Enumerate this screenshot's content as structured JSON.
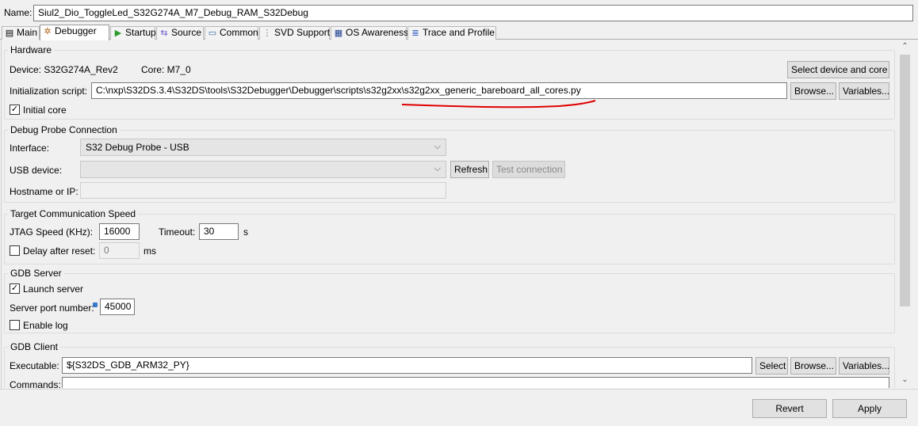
{
  "name_row": {
    "label": "Name:",
    "value": "Siul2_Dio_ToggleLed_S32G274A_M7_Debug_RAM_S32Debug"
  },
  "tabs": [
    {
      "label": "Main",
      "icon": "document-icon"
    },
    {
      "label": "Debugger",
      "icon": "bug-icon"
    },
    {
      "label": "Startup",
      "icon": "play-icon"
    },
    {
      "label": "Source",
      "icon": "source-icon"
    },
    {
      "label": "Common",
      "icon": "window-icon"
    },
    {
      "label": "SVD Support",
      "icon": "registers-icon"
    },
    {
      "label": "OS Awareness",
      "icon": "os-icon"
    },
    {
      "label": "Trace and Profile",
      "icon": "trace-icon"
    }
  ],
  "hardware": {
    "title": "Hardware",
    "device": "Device: S32G274A_Rev2",
    "core": "Core: M7_0",
    "select_button": "Select device and core",
    "init_label": "Initialization script:",
    "init_value": "C:\\nxp\\S32DS.3.4\\S32DS\\tools\\S32Debugger\\Debugger\\scripts\\s32g2xx\\s32g2xx_generic_bareboard_all_cores.py",
    "browse": "Browse...",
    "variables": "Variables...",
    "initial_core": "Initial core",
    "annotation_color": "#e00000"
  },
  "probe": {
    "title": "Debug Probe Connection",
    "interface_label": "Interface:",
    "interface_value": "S32 Debug Probe - USB",
    "usb_label": "USB device:",
    "usb_value": "",
    "refresh": "Refresh",
    "test": "Test connection",
    "host_label": "Hostname or IP:",
    "host_value": ""
  },
  "speed": {
    "title": "Target Communication Speed",
    "jtag_label": "JTAG Speed (KHz):",
    "jtag_value": "16000",
    "timeout_label": "Timeout:",
    "timeout_value": "30",
    "timeout_unit": "s",
    "delay_label": "Delay after reset:",
    "delay_value": "0",
    "delay_unit": "ms"
  },
  "gdb_server": {
    "title": "GDB Server",
    "launch": "Launch server",
    "port_label": "Server port number:",
    "port_value": "45000",
    "enable_log": "Enable log"
  },
  "gdb_client": {
    "title": "GDB Client",
    "exe_label": "Executable:",
    "exe_value": "${S32DS_GDB_ARM32_PY}",
    "select": "Select",
    "browse": "Browse...",
    "variables": "Variables...",
    "commands_label": "Commands:"
  },
  "footer": {
    "revert": "Revert",
    "apply": "Apply"
  }
}
